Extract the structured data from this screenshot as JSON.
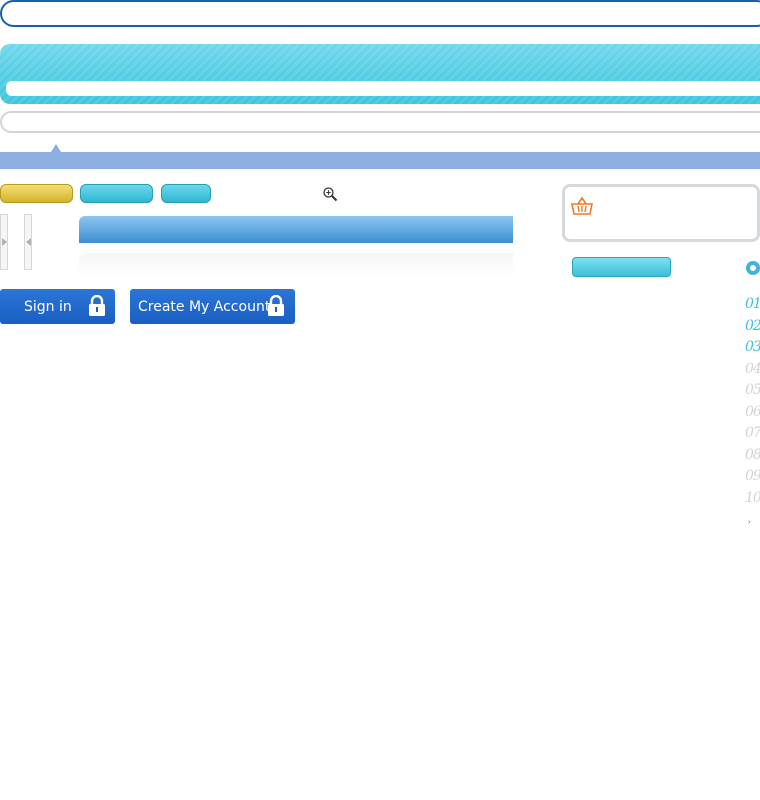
{
  "auth": {
    "signin_label": "Sign in",
    "create_label": "Create My Account"
  },
  "pagination": {
    "pages": [
      "01",
      "02",
      "03",
      "04",
      "05",
      "06",
      "07",
      "08",
      "09",
      "10"
    ],
    "active_pages": [
      "01",
      "02",
      "03"
    ],
    "next_symbol": "›"
  },
  "icons": {
    "zoom": "zoom-in-icon",
    "cart": "basket-icon",
    "lock": "lock-icon",
    "radio": "radio-icon"
  },
  "colors": {
    "top_border": "#1e5cb0",
    "header_cyan": "#3cc5de",
    "nav_strip": "#8daee0",
    "gold_button": "#d2b32a",
    "cyan_button": "#2fb7d3",
    "auth_button": "#1b5ec2",
    "basket_orange": "#f07a22",
    "page_active": "#3cbfdc",
    "page_inactive": "#d2d2d2"
  }
}
